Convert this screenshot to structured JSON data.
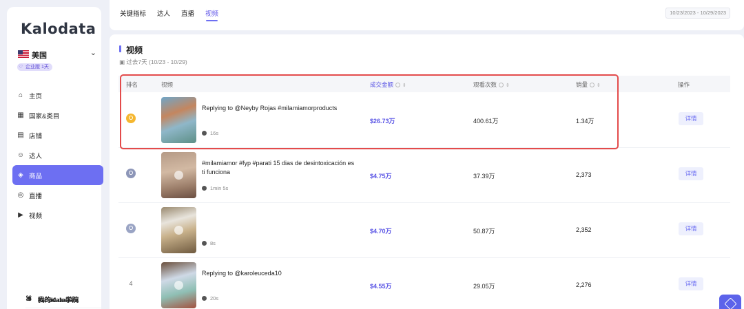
{
  "app": {
    "logo_text": "Kalodata",
    "region": "美国",
    "edition": "企业版 1天"
  },
  "sidebar": {
    "items": [
      {
        "label": "主页",
        "icon": "home-icon"
      },
      {
        "label": "国家&类目",
        "icon": "building-icon"
      },
      {
        "label": "店铺",
        "icon": "store-icon"
      },
      {
        "label": "达人",
        "icon": "creator-icon"
      },
      {
        "label": "商品",
        "icon": "box-icon"
      },
      {
        "label": "直播",
        "icon": "live-icon"
      },
      {
        "label": "视频",
        "icon": "video-icon"
      }
    ],
    "active_index": 4,
    "bottom": [
      {
        "label": "我的Kalodata",
        "icon": "user-icon"
      },
      {
        "label": "Kalodata学院",
        "icon": "academy-icon"
      }
    ]
  },
  "tabs": [
    "关键指标",
    "达人",
    "直播",
    "视频"
  ],
  "active_tab": "视频",
  "date_range": "10/23/2023 - 10/29/2023",
  "section": {
    "title": "视频",
    "period": "过去7天 (10/23 - 10/29)"
  },
  "table": {
    "headers": {
      "rank": "排名",
      "video": "视频",
      "gmv": "成交金额",
      "views": "观看次数",
      "sales": "销量",
      "action": "操作"
    },
    "rows": [
      {
        "rank": "1",
        "title": "Replying to @Neyby Rojas #milamiamorproducts",
        "duration": "16s",
        "gmv": "$26.73万",
        "views": "400.61万",
        "sales": "1.34万",
        "action": "详情"
      },
      {
        "rank": "2",
        "title": "#milamiamor #fyp #parati 15 dias de desintoxicación es ti funciona",
        "duration": "1min 5s",
        "gmv": "$4.75万",
        "views": "37.39万",
        "sales": "2,373",
        "action": "详情"
      },
      {
        "rank": "3",
        "title": "",
        "duration": "8s",
        "gmv": "$4.70万",
        "views": "50.87万",
        "sales": "2,352",
        "action": "详情"
      },
      {
        "rank": "4",
        "title": "Replying to @karoleuceda10",
        "duration": "20s",
        "gmv": "$4.55万",
        "views": "29.05万",
        "sales": "2,276",
        "action": "详情"
      }
    ]
  },
  "colors": {
    "accent": "#6d6ff2",
    "gmv_text": "#5a55e5",
    "highlight_box": "#e34b4b",
    "gold_medal": "#f5b730",
    "silver_medal": "#8d96b8"
  }
}
